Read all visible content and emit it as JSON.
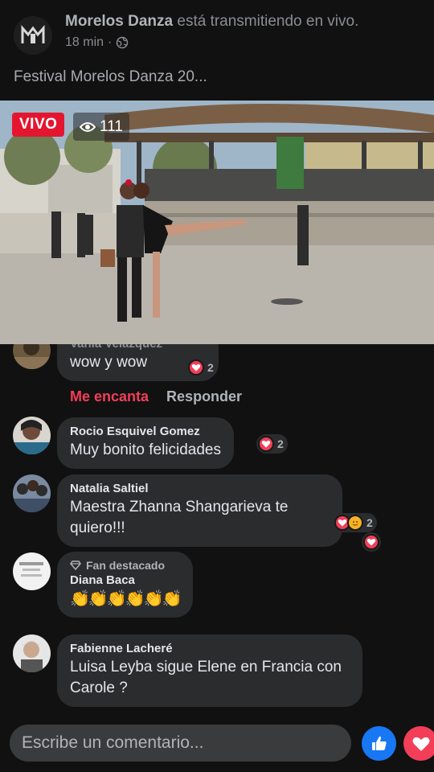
{
  "header": {
    "page_name": "Morelos Danza",
    "status_text": " está transmitiendo en vivo.",
    "time": "18 min",
    "separator": "·",
    "post_title": "Festival Morelos Danza 20..."
  },
  "video": {
    "live_label": "VIVO",
    "viewer_count": "111"
  },
  "comments": [
    {
      "author": "Vania Velázquez",
      "text": "wow y wow",
      "reaction_count": "2",
      "actions": {
        "love": "Me encanta",
        "reply": "Responder"
      }
    },
    {
      "author": "Rocio Esquivel Gomez",
      "text": "Muy bonito felicidades",
      "reaction_count": "2"
    },
    {
      "author": "Natalia Saltiel",
      "text": "Maestra Zhanna  Shangarieva te quiero!!!",
      "reaction_count": "2"
    },
    {
      "badge": "Fan destacado",
      "author": "Diana Baca",
      "text": "👏👏👏👏👏👏"
    },
    {
      "author": "Fabienne Lacheré",
      "text": "Luisa Leyba sigue Elene en Francia con Carole ?"
    }
  ],
  "composer": {
    "placeholder": "Escribe un comentario..."
  },
  "colors": {
    "live_red": "#e4162f",
    "love_red": "#f33e58",
    "like_blue": "#1877f2",
    "bubble": "#2b2c2e"
  },
  "icons": [
    "page-logo",
    "globe-icon",
    "eye-icon",
    "heart-icon",
    "hug-icon",
    "diamond-icon",
    "like-icon"
  ]
}
